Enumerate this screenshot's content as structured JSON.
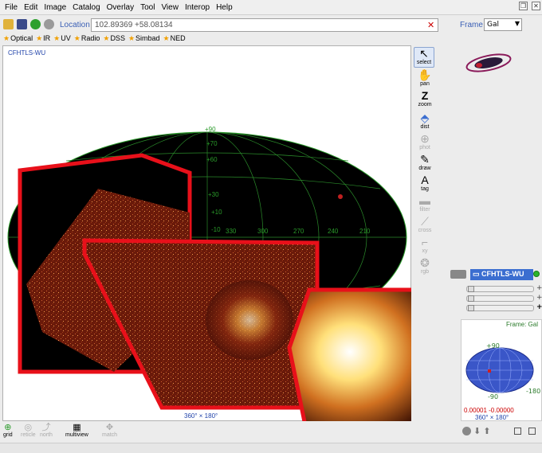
{
  "menu": [
    "File",
    "Edit",
    "Image",
    "Catalog",
    "Overlay",
    "Tool",
    "View",
    "Interop",
    "Help"
  ],
  "location": {
    "label": "Location",
    "value": "102.89369 +58.08134"
  },
  "frame": {
    "label": "Frame",
    "value": "Gal"
  },
  "bookmarks": [
    "Optical",
    "IR",
    "UV",
    "Radio",
    "DSS",
    "Simbad",
    "NED"
  ],
  "viewer": {
    "survey_label": "CFHTLS-WU",
    "fov": "360° × 180°",
    "grid_labels_lat": [
      "+90",
      "+70",
      "+60",
      "+30",
      "+10",
      "-10"
    ],
    "grid_labels_lon": [
      "330",
      "300",
      "270",
      "240",
      "210"
    ]
  },
  "tools": [
    {
      "name": "select",
      "label": "select",
      "glyph": "↖"
    },
    {
      "name": "pan",
      "label": "pan",
      "glyph": "✋"
    },
    {
      "name": "zoom",
      "label": "zoom",
      "glyph": "Z"
    },
    {
      "name": "dist",
      "label": "dist",
      "glyph": "⬘"
    },
    {
      "name": "phot",
      "label": "phot",
      "glyph": "⊕"
    },
    {
      "name": "draw",
      "label": "draw",
      "glyph": "✎"
    },
    {
      "name": "tag",
      "label": "tag",
      "glyph": "A"
    },
    {
      "name": "filter",
      "label": "filter",
      "glyph": "▬"
    },
    {
      "name": "cross",
      "label": "cross",
      "glyph": "⟋"
    },
    {
      "name": "xy",
      "label": "xy",
      "glyph": "⌐"
    },
    {
      "name": "rgb",
      "label": "rgb",
      "glyph": "❂"
    }
  ],
  "stack": {
    "plane": "CFHTLS-WU"
  },
  "mini": {
    "frame": "Frame: Gal",
    "coords": "0.00001 -0.00000",
    "fov": "360° × 180°",
    "lat_top": "+90",
    "lat_bottom": "-90",
    "lon_right": "-180"
  },
  "bottom_tools": [
    {
      "name": "grid",
      "label": "grid",
      "glyph": "⊕",
      "dim": false
    },
    {
      "name": "reticle",
      "label": "reticle",
      "glyph": "◎",
      "dim": true
    },
    {
      "name": "north",
      "label": "north",
      "glyph": "⤴",
      "dim": true
    },
    {
      "name": "multiview",
      "label": "multiview",
      "glyph": "▦",
      "dim": false
    },
    {
      "name": "match",
      "label": "match",
      "glyph": "✥",
      "dim": true
    }
  ],
  "colors": {
    "accent": "#3b6ed0",
    "zoom_border": "#e8101a",
    "grid": "#2a9a2a"
  }
}
